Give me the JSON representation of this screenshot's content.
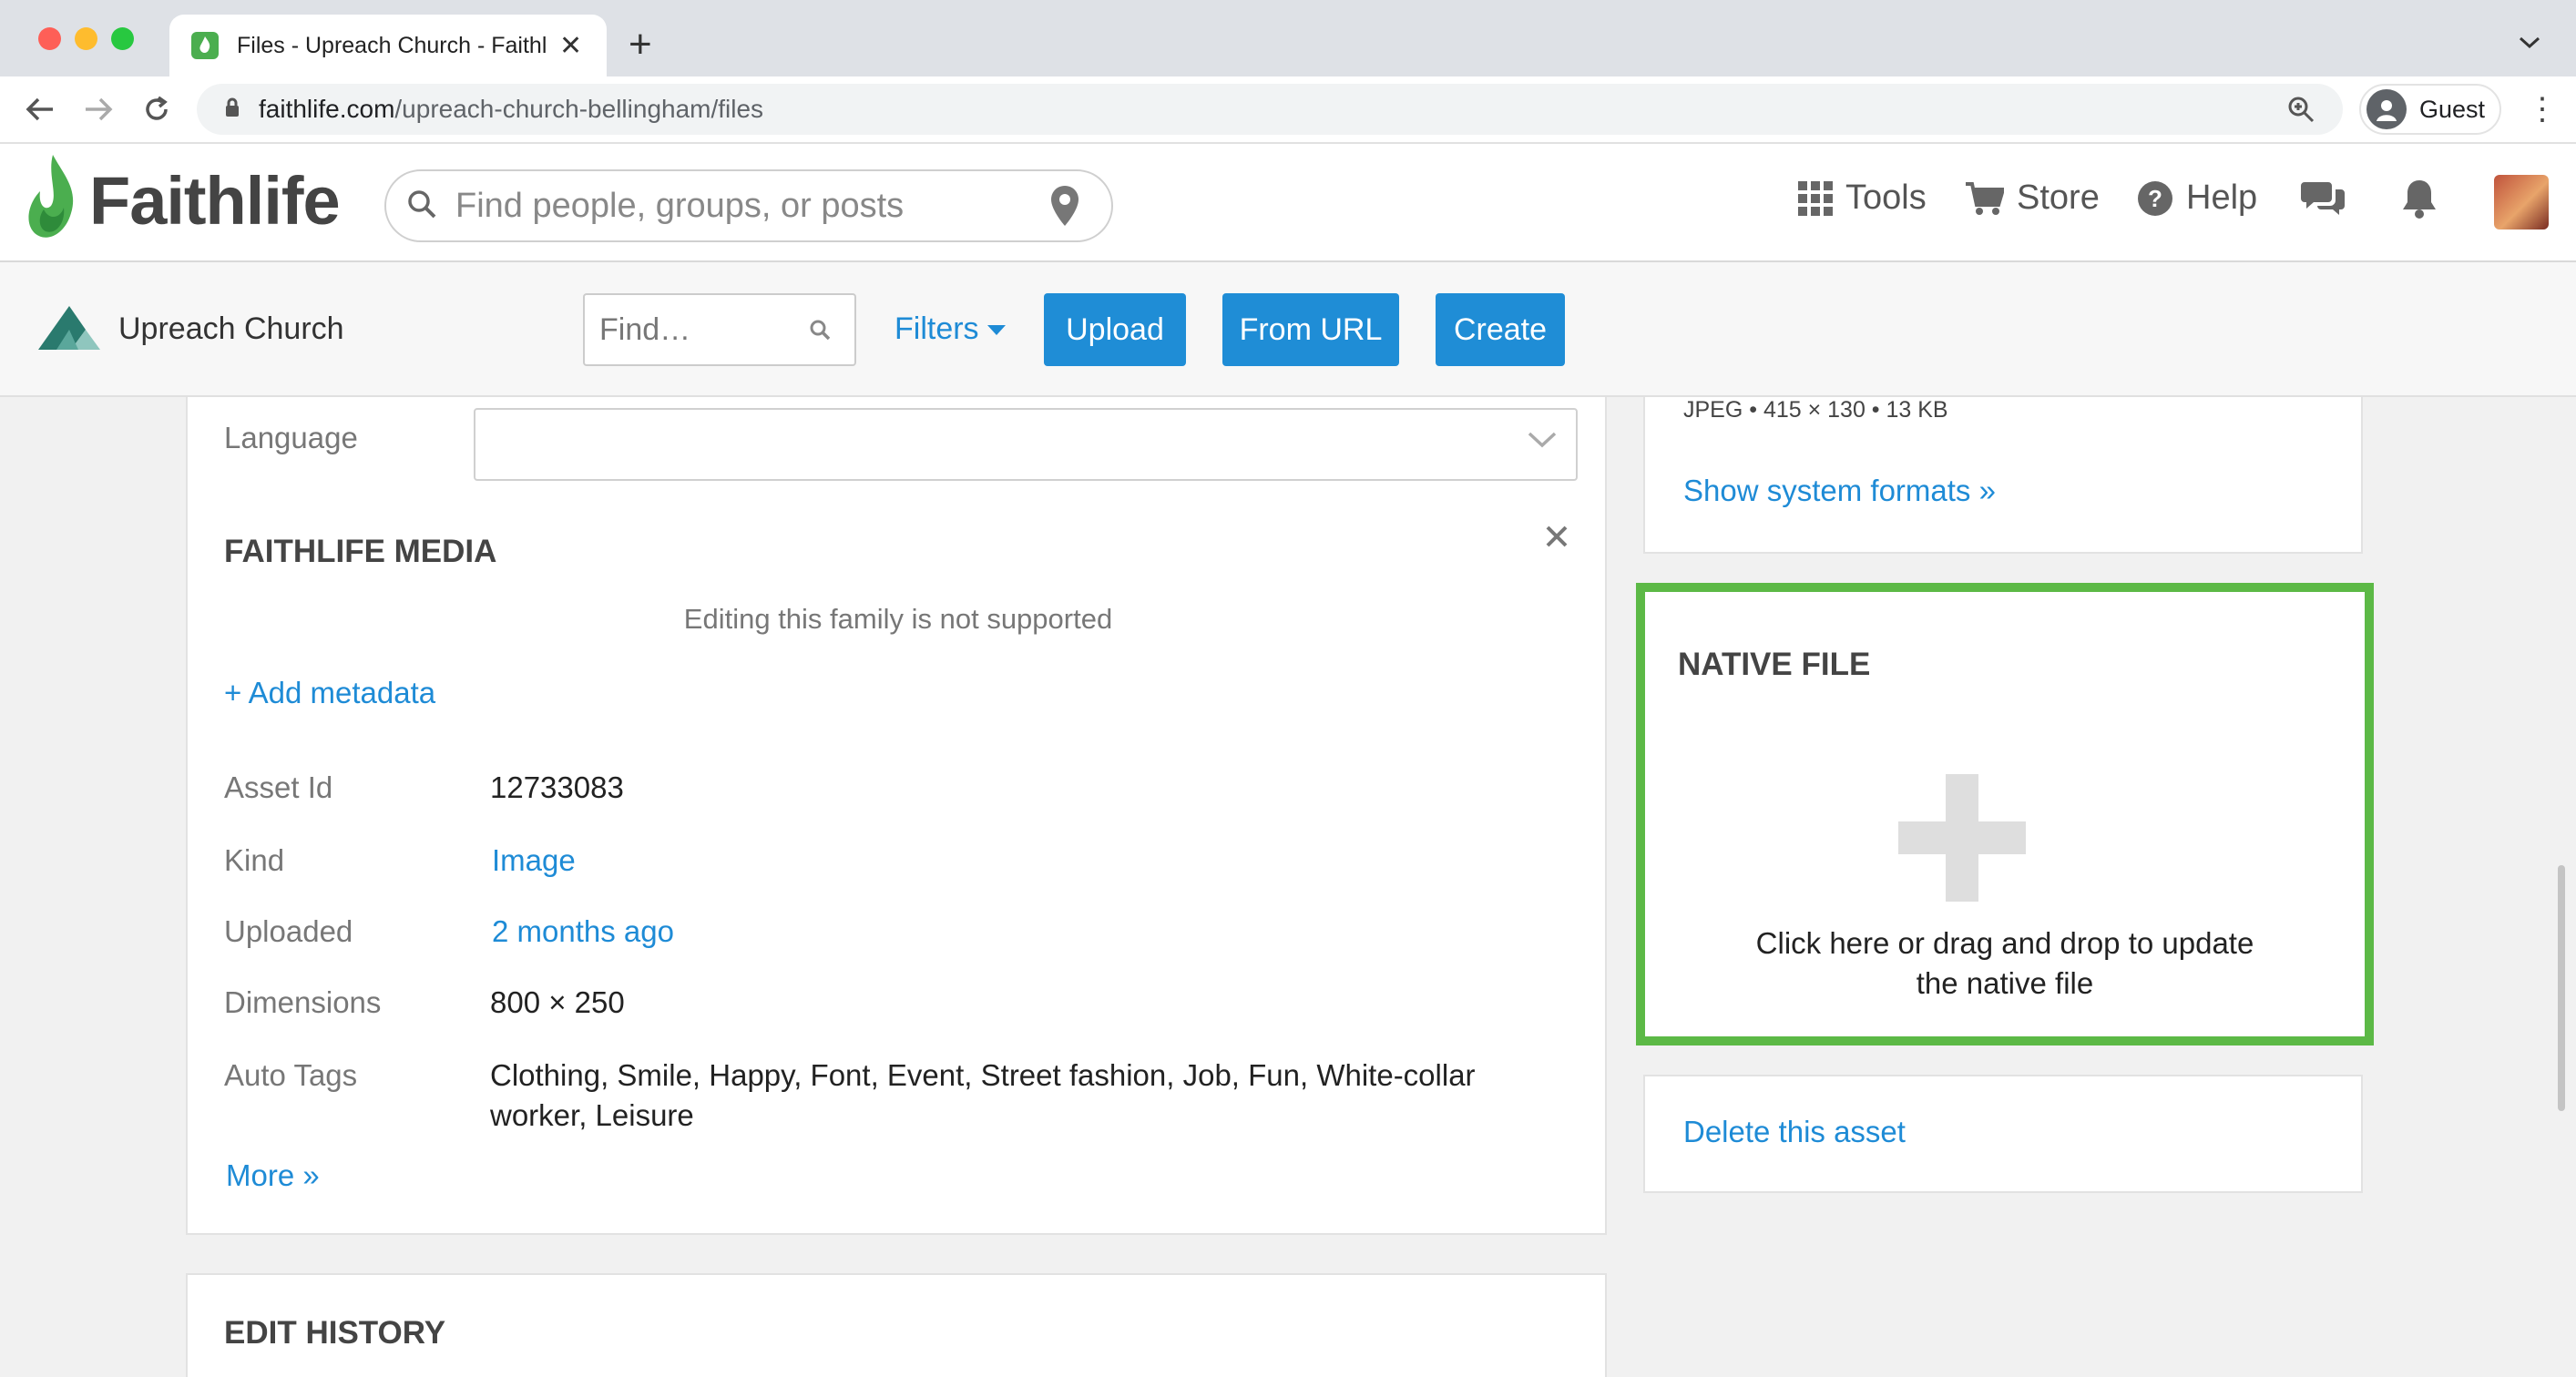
{
  "browser": {
    "tab_title": "Files - Upreach Church - Faithlife",
    "url_domain": "faithlife.com",
    "url_path": "/upreach-church-bellingham/files",
    "profile_label": "Guest"
  },
  "header": {
    "logo_text": "Faithlife",
    "search_placeholder": "Find people, groups, or posts",
    "nav": {
      "tools": "Tools",
      "store": "Store",
      "help": "Help"
    }
  },
  "subheader": {
    "church_name": "Upreach Church",
    "find_placeholder": "Find…",
    "filters_label": "Filters",
    "upload_label": "Upload",
    "from_url_label": "From URL",
    "create_label": "Create"
  },
  "details": {
    "language_label": "Language",
    "language_value": "",
    "faithlife_media_title": "FAITHLIFE MEDIA",
    "editing_note": "Editing this family is not supported",
    "add_metadata": "+ Add metadata",
    "fields": {
      "asset_id_label": "Asset Id",
      "asset_id_value": "12733083",
      "kind_label": "Kind",
      "kind_value": "Image",
      "uploaded_label": "Uploaded",
      "uploaded_value": "2 months ago",
      "dimensions_label": "Dimensions",
      "dimensions_value": "800 × 250",
      "auto_tags_label": "Auto Tags",
      "auto_tags_line1": "Clothing, Smile, Happy, Font, Event, Street fashion, Job, Fun, White-collar",
      "auto_tags_line2": "worker, Leisure"
    },
    "more_link": "More »",
    "edit_history_title": "EDIT HISTORY"
  },
  "sidebar": {
    "format_info": "JPEG • 415 × 130 • 13 KB",
    "show_formats": "Show system formats »",
    "native_file_title": "NATIVE FILE",
    "native_msg_line1": "Click here or drag and drop to update",
    "native_msg_line2": "the native file",
    "delete_asset": "Delete this asset"
  },
  "colors": {
    "accent_blue": "#1f8dd6",
    "highlight_green": "#5cb946",
    "brand_green": "#4bae4f"
  }
}
